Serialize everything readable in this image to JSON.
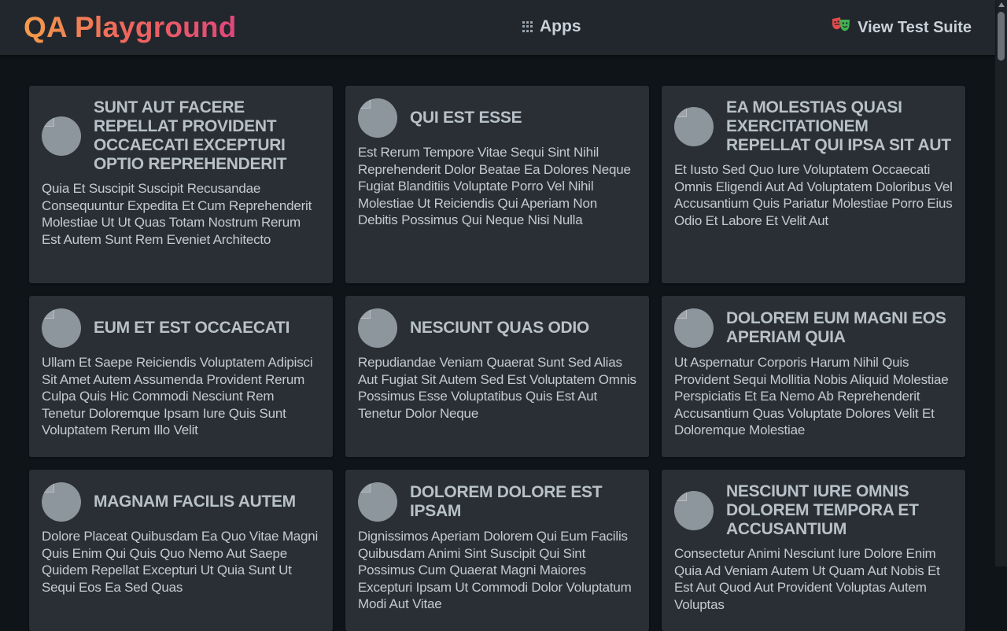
{
  "header": {
    "logo": "QA Playground",
    "apps_label": "Apps",
    "suite_label": "View Test Suite"
  },
  "posts": [
    {
      "title": "sunt aut facere repellat provident occaecati excepturi optio reprehenderit",
      "body": "quia et suscipit suscipit recusandae consequuntur expedita et cum reprehenderit molestiae ut ut quas totam nostrum rerum est autem sunt rem eveniet architecto"
    },
    {
      "title": "qui est esse",
      "body": "est rerum tempore vitae sequi sint nihil reprehenderit dolor beatae ea dolores neque fugiat blanditiis voluptate porro vel nihil molestiae ut reiciendis qui aperiam non debitis possimus qui neque nisi nulla"
    },
    {
      "title": "ea molestias quasi exercitationem repellat qui ipsa sit aut",
      "body": "et iusto sed quo iure voluptatem occaecati omnis eligendi aut ad voluptatem doloribus vel accusantium quis pariatur molestiae porro eius odio et labore et velit aut"
    },
    {
      "title": "eum et est occaecati",
      "body": "ullam et saepe reiciendis voluptatem adipisci sit amet autem assumenda provident rerum culpa quis hic commodi nesciunt rem tenetur doloremque ipsam iure quis sunt voluptatem rerum illo velit"
    },
    {
      "title": "nesciunt quas odio",
      "body": "repudiandae veniam quaerat sunt sed alias aut fugiat sit autem sed est voluptatem omnis possimus esse voluptatibus quis est aut tenetur dolor neque"
    },
    {
      "title": "dolorem eum magni eos aperiam quia",
      "body": "ut aspernatur corporis harum nihil quis provident sequi mollitia nobis aliquid molestiae perspiciatis et ea nemo ab reprehenderit accusantium quas voluptate dolores velit et doloremque molestiae"
    },
    {
      "title": "magnam facilis autem",
      "body": "dolore placeat quibusdam ea quo vitae magni quis enim qui quis quo nemo aut saepe quidem repellat excepturi ut quia sunt ut sequi eos ea sed quas"
    },
    {
      "title": "dolorem dolore est ipsam",
      "body": "dignissimos aperiam dolorem qui eum facilis quibusdam animi sint suscipit qui sint possimus cum quaerat magni maiores excepturi ipsam ut commodi dolor voluptatum modi aut vitae"
    },
    {
      "title": "nesciunt iure omnis dolorem tempora et accusantium",
      "body": "consectetur animi nesciunt iure dolore enim quia ad veniam autem ut quam aut nobis et est aut quod aut provident voluptas autem voluptas"
    }
  ]
}
